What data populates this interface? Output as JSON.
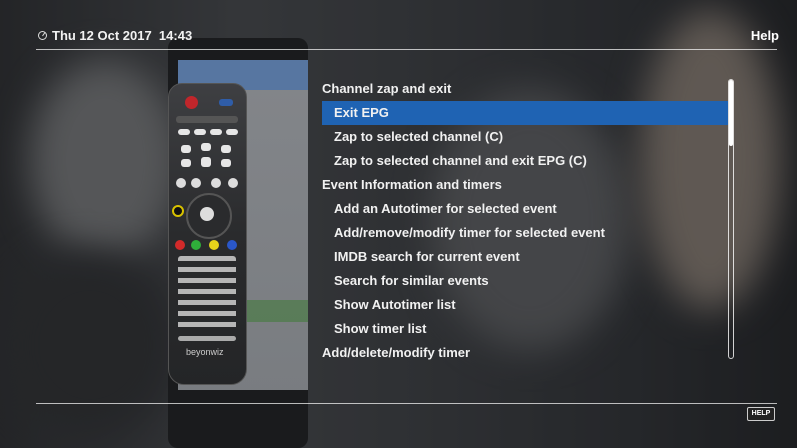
{
  "header": {
    "date_time": "Thu 12 Oct 2017  14:43",
    "clock_icon": "clock-icon",
    "title": "Help"
  },
  "menu": {
    "items": [
      {
        "label": "Channel zap and exit",
        "level": 0,
        "selected": false
      },
      {
        "label": "Exit EPG",
        "level": 1,
        "selected": true
      },
      {
        "label": "Zap to selected channel (C)",
        "level": 1,
        "selected": false
      },
      {
        "label": "Zap to selected channel and exit EPG (C)",
        "level": 1,
        "selected": false
      },
      {
        "label": "Event Information and timers",
        "level": 0,
        "selected": false
      },
      {
        "label": "Add an Autotimer for selected event",
        "level": 1,
        "selected": false
      },
      {
        "label": "Add/remove/modify timer for selected event",
        "level": 1,
        "selected": false
      },
      {
        "label": "IMDB search for current event",
        "level": 1,
        "selected": false
      },
      {
        "label": "Search for similar events",
        "level": 1,
        "selected": false
      },
      {
        "label": "Show Autotimer list",
        "level": 1,
        "selected": false
      },
      {
        "label": "Show timer list",
        "level": 1,
        "selected": false
      },
      {
        "label": "Add/delete/modify timer",
        "level": 0,
        "selected": false
      }
    ],
    "selected_color": "#1f63b3"
  },
  "remote": {
    "brand": "beyonwiz"
  },
  "footer": {
    "help_key": "HELP"
  }
}
